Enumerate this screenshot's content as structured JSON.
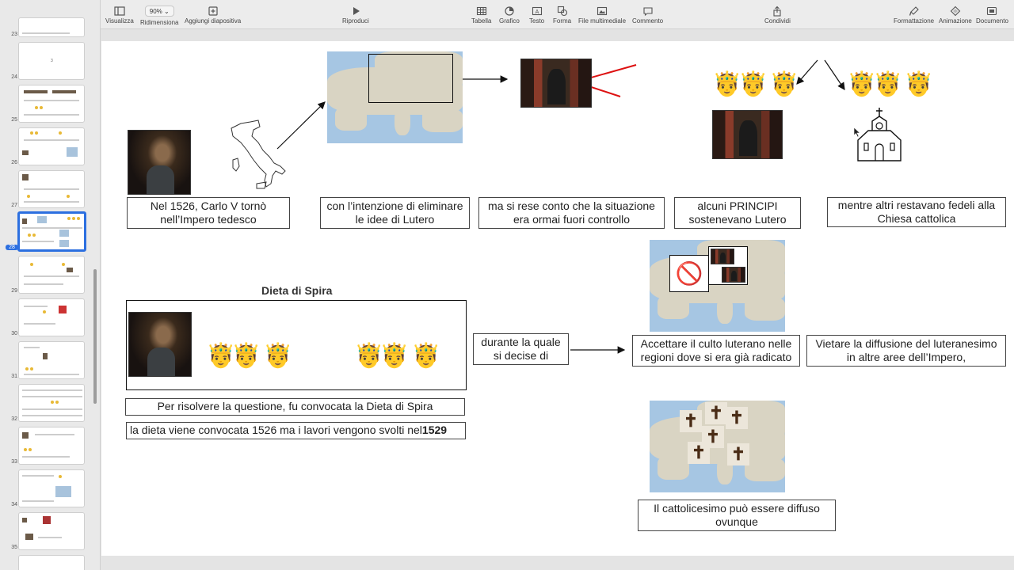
{
  "toolbar": {
    "view": "Visualizza",
    "zoom_value": "90%",
    "zoom": "Ridimensiona",
    "add_slide": "Aggiungi diapositiva",
    "play": "Riproduci",
    "table": "Tabella",
    "chart": "Grafico",
    "text": "Testo",
    "shape": "Forma",
    "media": "File multimediale",
    "comment": "Commento",
    "share": "Condividi",
    "format": "Formattazione",
    "animate": "Animazione",
    "document": "Documento"
  },
  "navigator": {
    "slide_numbers": [
      "23",
      "24",
      "25",
      "26",
      "27",
      "28",
      "29",
      "30",
      "31",
      "32",
      "33",
      "34",
      "35"
    ],
    "selected": "28",
    "thumb_24_text": "3"
  },
  "slide": {
    "box1": "Nel 1526, Carlo V tornò nell’Impero tedesco",
    "box2": "con l’intenzione di eliminare le idee di Lutero",
    "box3": "ma si rese conto che la situazione era ormai fuori controllo",
    "box4": "alcuni PRINCIPI sostenevano Lutero",
    "box5": "mentre altri restavano fedeli alla Chiesa cattolica",
    "diet_title": "Dieta di Spira",
    "box_convened": "Per risolvere la questione, fu convocata la Dieta di Spira",
    "box_dates_pre": "la dieta viene convocata 1526 ma i lavori vengono svolti nel ",
    "box_dates_year": "1529",
    "box_decided": "durante la quale si decise di",
    "box_accept": "Accettare il culto luterano nelle regioni dove si era già radicato",
    "box_forbid": "Vietare la diffusione del luteranesimo in altre aree dell’Impero,",
    "box_catholic": "Il cattolicesimo può essere diffuso ovunque",
    "prince_emoji": "🤴",
    "no_entry_emoji": "🚫",
    "cross_glyph": "✝"
  }
}
